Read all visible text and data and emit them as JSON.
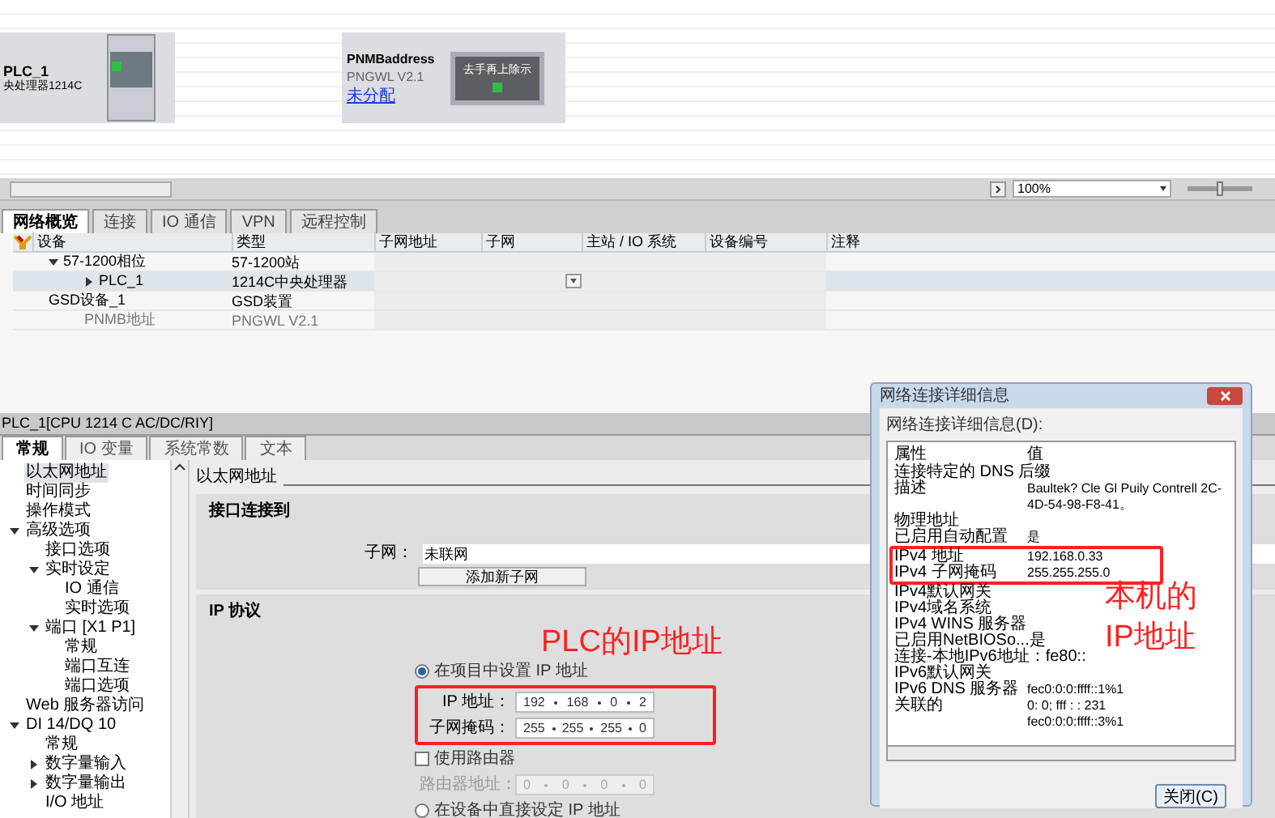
{
  "canvas": {
    "devices": [
      {
        "kind": "plc",
        "name": "PLC_1",
        "type": "央处理器1214C"
      },
      {
        "kind": "gateway",
        "name": "PNMBaddress",
        "type": "PNGWL V2.1",
        "link": "未分配",
        "module_label": "去手再上除示"
      }
    ]
  },
  "zoom": {
    "value": "100%",
    "level": 0.5
  },
  "overview_tabs": [
    {
      "label": "网络概览",
      "selected": true
    },
    {
      "label": "连接",
      "selected": false
    },
    {
      "label": "IO 通信",
      "selected": false
    },
    {
      "label": "VPN",
      "selected": false
    },
    {
      "label": "远程控制",
      "selected": false
    }
  ],
  "overview_table": {
    "columns": [
      "设备",
      "类型",
      "子网地址",
      "子网",
      "主站 / IO 系统",
      "设备编号",
      "注释"
    ],
    "rows": [
      {
        "device": "57-1200相位",
        "type": "57-1200站",
        "expanded": true,
        "selected": false,
        "disabled": false,
        "children": [
          {
            "device": "PLC_1",
            "type": "1214C中央处理器",
            "expanded": false,
            "selected": true,
            "disabled": false
          }
        ]
      },
      {
        "device": "GSD设备_1",
        "type": "GSD装置",
        "selected": false,
        "disabled": false,
        "children": [
          {
            "device": "PNMB地址",
            "type": "PNGWL V2.1",
            "selected": false,
            "disabled": true
          }
        ]
      }
    ]
  },
  "inspector": {
    "title": "PLC_1[CPU 1214 C AC/DC/RIY]",
    "tabs": [
      {
        "label": "常规",
        "selected": true
      },
      {
        "label": "IO 变量",
        "selected": false
      },
      {
        "label": "系统常数",
        "selected": false
      },
      {
        "label": "文本",
        "selected": false
      }
    ],
    "tree": [
      {
        "label": "以太网地址",
        "selected": true
      },
      {
        "label": "时间同步",
        "selected": false
      },
      {
        "label": "操作模式",
        "selected": false
      },
      {
        "label": "高级选项",
        "selected": false,
        "expanded": true,
        "children": [
          {
            "label": "接口选项",
            "selected": false
          },
          {
            "label": "实时设定",
            "selected": false,
            "expanded": true,
            "children": [
              {
                "label": "IO 通信",
                "selected": false
              },
              {
                "label": "实时选项",
                "selected": false
              }
            ]
          },
          {
            "label": "端口 [X1 P1]",
            "selected": false,
            "expanded": true,
            "children": [
              {
                "label": "常规",
                "selected": false
              },
              {
                "label": "端口互连",
                "selected": false
              },
              {
                "label": "端口选项",
                "selected": false
              }
            ]
          }
        ]
      },
      {
        "label": "Web 服务器访问",
        "selected": false
      },
      {
        "label": "DI 14/DQ 10",
        "selected": false,
        "expanded": true,
        "children": [
          {
            "label": "常规",
            "selected": false
          },
          {
            "label": "数字量输入",
            "selected": false,
            "expanded": false
          },
          {
            "label": "数字量输出",
            "selected": false,
            "expanded": false
          },
          {
            "label": "I/O 地址",
            "selected": false
          }
        ]
      }
    ],
    "section_title": "以太网地址",
    "interface": {
      "heading": "接口连接到",
      "subnet_label": "子网：",
      "subnet_value": "未联网",
      "add_button": "添加新子网"
    },
    "ip": {
      "heading": "IP 协议",
      "options": [
        {
          "label": "在项目中设置 IP 地址",
          "selected": true
        },
        {
          "label": "在设备中直接设定 IP 地址",
          "selected": false
        }
      ],
      "address_label": "IP 地址：",
      "address": [
        "192",
        "168",
        "0",
        "2"
      ],
      "mask_label": "子网掩码：",
      "mask": [
        "255",
        "255",
        "255",
        "0"
      ],
      "router": {
        "label": "使用路由器",
        "checked": false
      },
      "router_address_label": "路由器地址：",
      "router_address": [
        "0",
        "0",
        "0",
        "0"
      ]
    }
  },
  "dialog": {
    "title": "网络连接详细信息",
    "caption": "网络连接详细信息(D):",
    "columns": [
      "属性",
      "值"
    ],
    "rows": [
      {
        "property": "连接特定的 DNS 后缀"
      },
      {
        "property": "描述",
        "value": "Baultek? Cle Gl Puily Contrell 2C-4D-54-98-F8-41。"
      },
      {
        "property": "物理地址"
      },
      {
        "property": "已启用自动配置",
        "value": "是"
      },
      {
        "property": "IPv4 地址",
        "value": "192.168.0.33"
      },
      {
        "property": "IPv4 子网掩码",
        "value": "255.255.255.0"
      },
      {
        "property": "IPv4默认网关"
      },
      {
        "property": "IPv4域名系统"
      },
      {
        "property": "IPv4 WINS 服务器"
      },
      {
        "property": "已启用NetBIOSo...是"
      },
      {
        "property": "连接-本地IPv6地址：fe80::"
      },
      {
        "property": "IPv6默认网关"
      },
      {
        "property": "IPv6 DNS 服务器",
        "value": "fec0:0:0:ffff::1%1"
      },
      {
        "property": "关联的",
        "value": "0: 0; fff : : 231"
      },
      {
        "value": "fec0:0:0:ffff::3%1"
      }
    ],
    "close_button": "关闭(C)"
  },
  "annotations": {
    "plc": "PLC的IP地址",
    "pc": [
      "本机的",
      "IP地址"
    ]
  }
}
